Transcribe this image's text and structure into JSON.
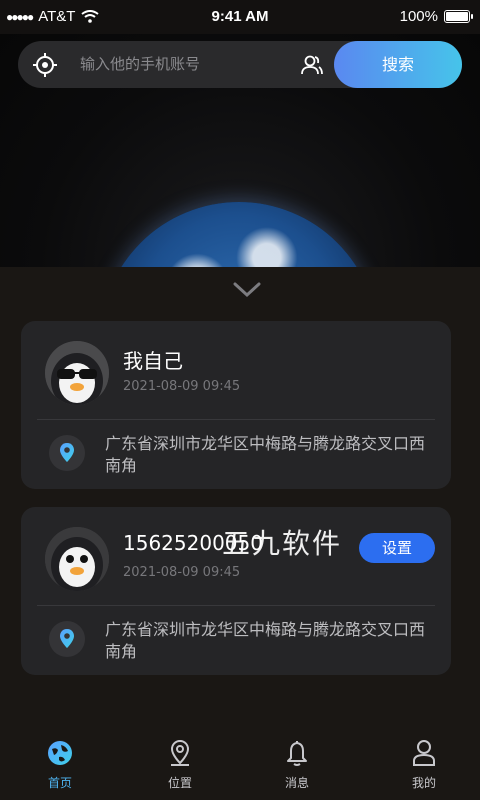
{
  "status_bar": {
    "carrier": "AT&T",
    "time": "9:41 AM",
    "battery": "100%"
  },
  "search": {
    "placeholder": "输入他的手机账号",
    "button_label": "搜索"
  },
  "cards": [
    {
      "name": "我自己",
      "time": "2021-08-09   09:45",
      "address": "广东省深圳市龙华区中梅路与腾龙路交叉口西南角"
    },
    {
      "name": "15625200050",
      "time": "2021-08-09   09:45",
      "address": "广东省深圳市龙华区中梅路与腾龙路交叉口西南角",
      "button_label": "设置"
    }
  ],
  "watermark": "五九软件",
  "tabs": [
    {
      "label": "首页",
      "icon": "globe-icon",
      "active": true
    },
    {
      "label": "位置",
      "icon": "location-pin-icon",
      "active": false
    },
    {
      "label": "消息",
      "icon": "bell-icon",
      "active": false
    },
    {
      "label": "我的",
      "icon": "user-icon",
      "active": false
    }
  ],
  "colors": {
    "accent": "#2c6ef0",
    "active_tab": "#4fb3f0"
  }
}
